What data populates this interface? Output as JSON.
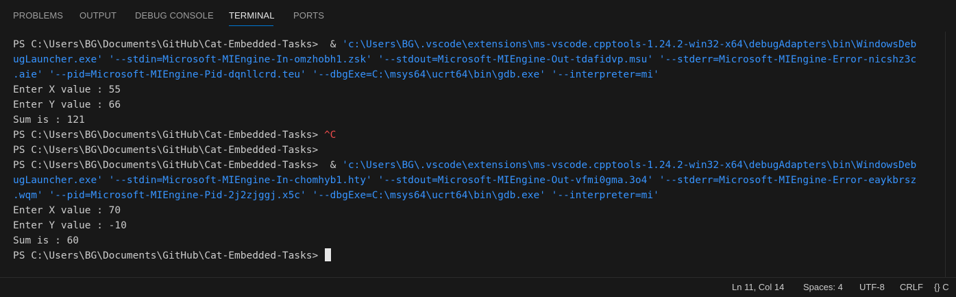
{
  "panel": {
    "tabs": [
      {
        "label": "PROBLEMS",
        "active": false
      },
      {
        "label": "OUTPUT",
        "active": false
      },
      {
        "label": "DEBUG CONSOLE",
        "active": false
      },
      {
        "label": "TERMINAL",
        "active": true
      },
      {
        "label": "PORTS",
        "active": false
      }
    ]
  },
  "terminal": {
    "lines": [
      {
        "plain": "PS C:\\Users\\BG\\Documents\\GitHub\\Cat-Embedded-Tasks>  & ",
        "highlight": "'c:\\Users\\BG\\.vscode\\extensions\\ms-vscode.cpptools-1.24.2-win32-x64\\debugAdapters\\bin\\WindowsDeb"
      },
      {
        "plain": "",
        "highlight": "ugLauncher.exe' '--stdin=Microsoft-MIEngine-In-omzhobh1.zsk' '--stdout=Microsoft-MIEngine-Out-tdafidvp.msu' '--stderr=Microsoft-MIEngine-Error-nicshz3c"
      },
      {
        "plain": "",
        "highlight": ".aie' '--pid=Microsoft-MIEngine-Pid-dqnllcrd.teu' '--dbgExe=C:\\msys64\\ucrt64\\bin\\gdb.exe' '--interpreter=mi'"
      },
      {
        "plain": "Enter X value : 55",
        "highlight": ""
      },
      {
        "plain": "Enter Y value : 66",
        "highlight": ""
      },
      {
        "plain": "Sum is : 121",
        "highlight": ""
      },
      {
        "plain": "PS C:\\Users\\BG\\Documents\\GitHub\\Cat-Embedded-Tasks> ",
        "highlight": "",
        "ctrl": "^C"
      },
      {
        "plain": "PS C:\\Users\\BG\\Documents\\GitHub\\Cat-Embedded-Tasks>",
        "highlight": ""
      },
      {
        "plain": "PS C:\\Users\\BG\\Documents\\GitHub\\Cat-Embedded-Tasks>  & ",
        "highlight": "'c:\\Users\\BG\\.vscode\\extensions\\ms-vscode.cpptools-1.24.2-win32-x64\\debugAdapters\\bin\\WindowsDeb"
      },
      {
        "plain": "",
        "highlight": "ugLauncher.exe' '--stdin=Microsoft-MIEngine-In-chomhyb1.hty' '--stdout=Microsoft-MIEngine-Out-vfmi0gma.3o4' '--stderr=Microsoft-MIEngine-Error-eaykbrsz"
      },
      {
        "plain": "",
        "highlight": ".wqm' '--pid=Microsoft-MIEngine-Pid-2j2zjggj.x5c' '--dbgExe=C:\\msys64\\ucrt64\\bin\\gdb.exe' '--interpreter=mi'"
      },
      {
        "plain": "Enter X value : 70",
        "highlight": ""
      },
      {
        "plain": "Enter Y value : -10",
        "highlight": ""
      },
      {
        "plain": "Sum is : 60",
        "highlight": ""
      },
      {
        "plain": "PS C:\\Users\\BG\\Documents\\GitHub\\Cat-Embedded-Tasks> ",
        "highlight": "",
        "cursor": true
      }
    ]
  },
  "status": {
    "position": "Ln 11, Col 14",
    "spaces": "Spaces: 4",
    "encoding": "UTF-8",
    "eol": "CRLF",
    "language": "{} C"
  },
  "colors": {
    "background": "#181818",
    "text": "#cccccc",
    "string": "#3794ff",
    "control": "#f14c4c",
    "activeTabUnderline": "#0078d4"
  }
}
